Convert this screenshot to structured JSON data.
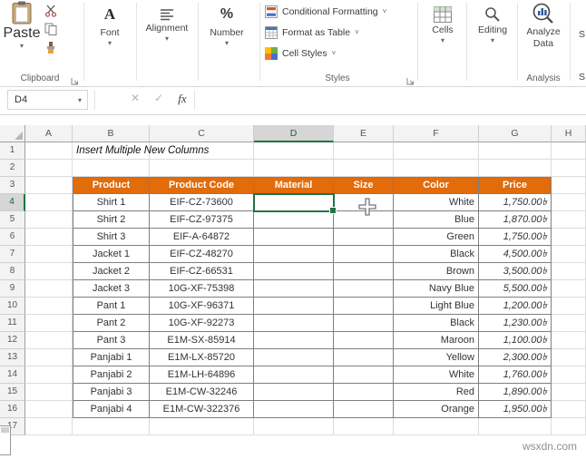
{
  "colors": {
    "table_header_bg": "#E26B0A",
    "selection_green": "#217346",
    "grid_line": "#DCDCDC",
    "table_border": "#7F7F7F"
  },
  "icons": {
    "dropdown": "▾",
    "small_chevron": "˅"
  },
  "ribbon": {
    "paste_label": "Paste",
    "clipboard_group": "Clipboard",
    "font": "Font",
    "alignment": "Alignment",
    "number": "Number",
    "conditional_formatting": "Conditional Formatting",
    "format_as_table": "Format as Table",
    "cell_styles": "Cell Styles",
    "styles_group": "Styles",
    "cells": "Cells",
    "editing": "Editing",
    "analyze_line1": "Analyze",
    "analyze_line2": "Data",
    "analysis_group": "Analysis",
    "clipped_text": "S"
  },
  "formula_bar": {
    "name_box": "D4",
    "cancel": "✕",
    "enter": "✓",
    "fx": "fx",
    "value": ""
  },
  "sheet": {
    "column_letters": [
      "A",
      "B",
      "C",
      "D",
      "E",
      "F",
      "G",
      "H"
    ],
    "row_count": 17,
    "selected_cell": "D4",
    "selected_column": "D",
    "selected_row": 4,
    "title_cell": {
      "ref": "B1",
      "text": "Insert Multiple New Columns"
    }
  },
  "table": {
    "header_row": 3,
    "first_data_row": 4,
    "columns": [
      "B",
      "C",
      "D",
      "E",
      "F",
      "G"
    ],
    "headers": [
      "Product",
      "Product Code",
      "Material",
      "Size",
      "Color",
      "Price"
    ],
    "rows": [
      [
        "Shirt 1",
        "EIF-CZ-73600",
        "",
        "",
        "White",
        "1,750.00৳"
      ],
      [
        "Shirt 2",
        "EIF-CZ-97375",
        "",
        "",
        "Blue",
        "1,870.00৳"
      ],
      [
        "Shirt 3",
        "EIF-A-64872",
        "",
        "",
        "Green",
        "1,750.00৳"
      ],
      [
        "Jacket 1",
        "EIF-CZ-48270",
        "",
        "",
        "Black",
        "4,500.00৳"
      ],
      [
        "Jacket 2",
        "EIF-CZ-66531",
        "",
        "",
        "Brown",
        "3,500.00৳"
      ],
      [
        "Jacket 3",
        "10G-XF-75398",
        "",
        "",
        "Navy Blue",
        "5,500.00৳"
      ],
      [
        "Pant 1",
        "10G-XF-96371",
        "",
        "",
        "Light Blue",
        "1,200.00৳"
      ],
      [
        "Pant 2",
        "10G-XF-92273",
        "",
        "",
        "Black",
        "1,230.00৳"
      ],
      [
        "Pant 3",
        "E1M-SX-85914",
        "",
        "",
        "Maroon",
        "1,100.00৳"
      ],
      [
        "Panjabi 1",
        "E1M-LX-85720",
        "",
        "",
        "Yellow",
        "2,300.00৳"
      ],
      [
        "Panjabi 2",
        "E1M-LH-64896",
        "",
        "",
        "White",
        "1,760.00৳"
      ],
      [
        "Panjabi 3",
        "E1M-CW-32246",
        "",
        "",
        "Red",
        "1,890.00৳"
      ],
      [
        "Panjabi 4",
        "E1M-CW-322376",
        "",
        "",
        "Orange",
        "1,950.00৳"
      ]
    ]
  },
  "watermark": "wsxdn.com"
}
